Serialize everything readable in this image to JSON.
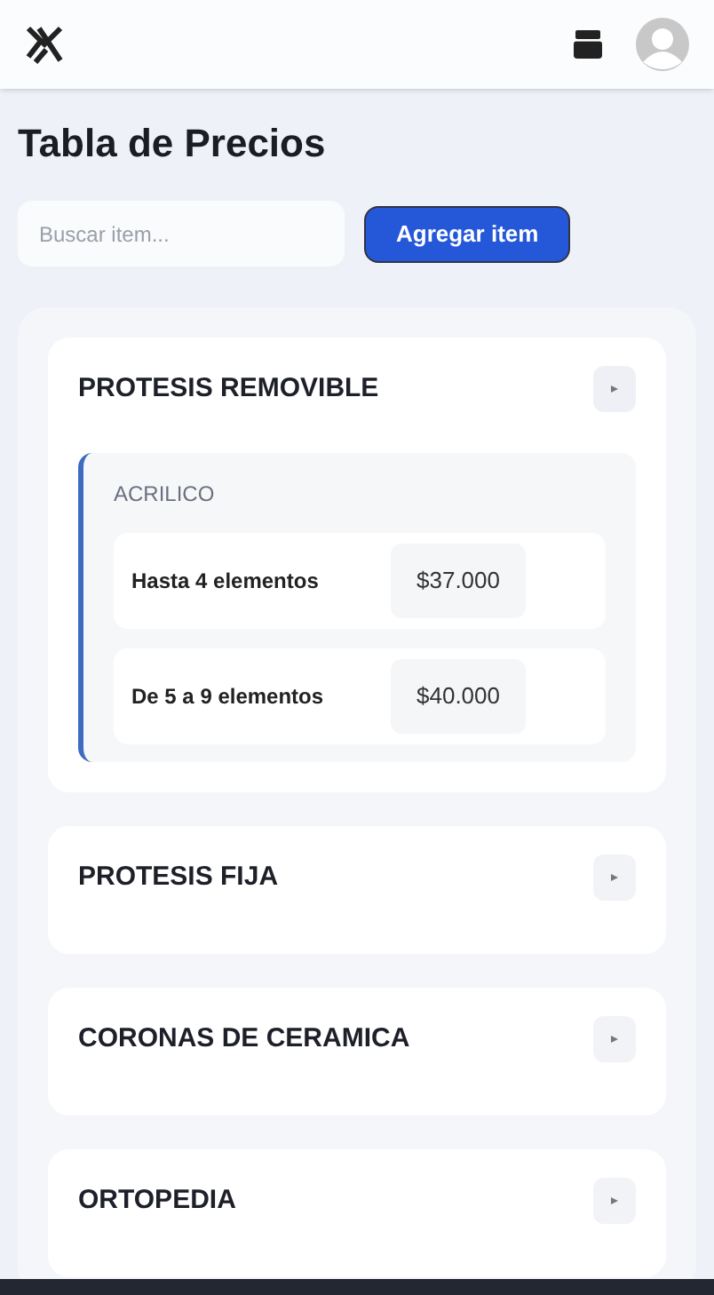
{
  "page_title": "Tabla de Precios",
  "search": {
    "placeholder": "Buscar item..."
  },
  "add_button": "Agregar item",
  "categories": [
    {
      "name": "PROTESIS REMOVIBLE",
      "expanded": true,
      "groups": [
        {
          "name": "ACRILICO",
          "items": [
            {
              "label": "Hasta 4 elementos",
              "price": "$37.000"
            },
            {
              "label": "De 5 a 9 elementos",
              "price": "$40.000"
            }
          ]
        }
      ]
    },
    {
      "name": "PROTESIS FIJA",
      "expanded": false
    },
    {
      "name": "CORONAS DE CERAMICA",
      "expanded": false
    },
    {
      "name": "ORTOPEDIA",
      "expanded": false
    }
  ]
}
